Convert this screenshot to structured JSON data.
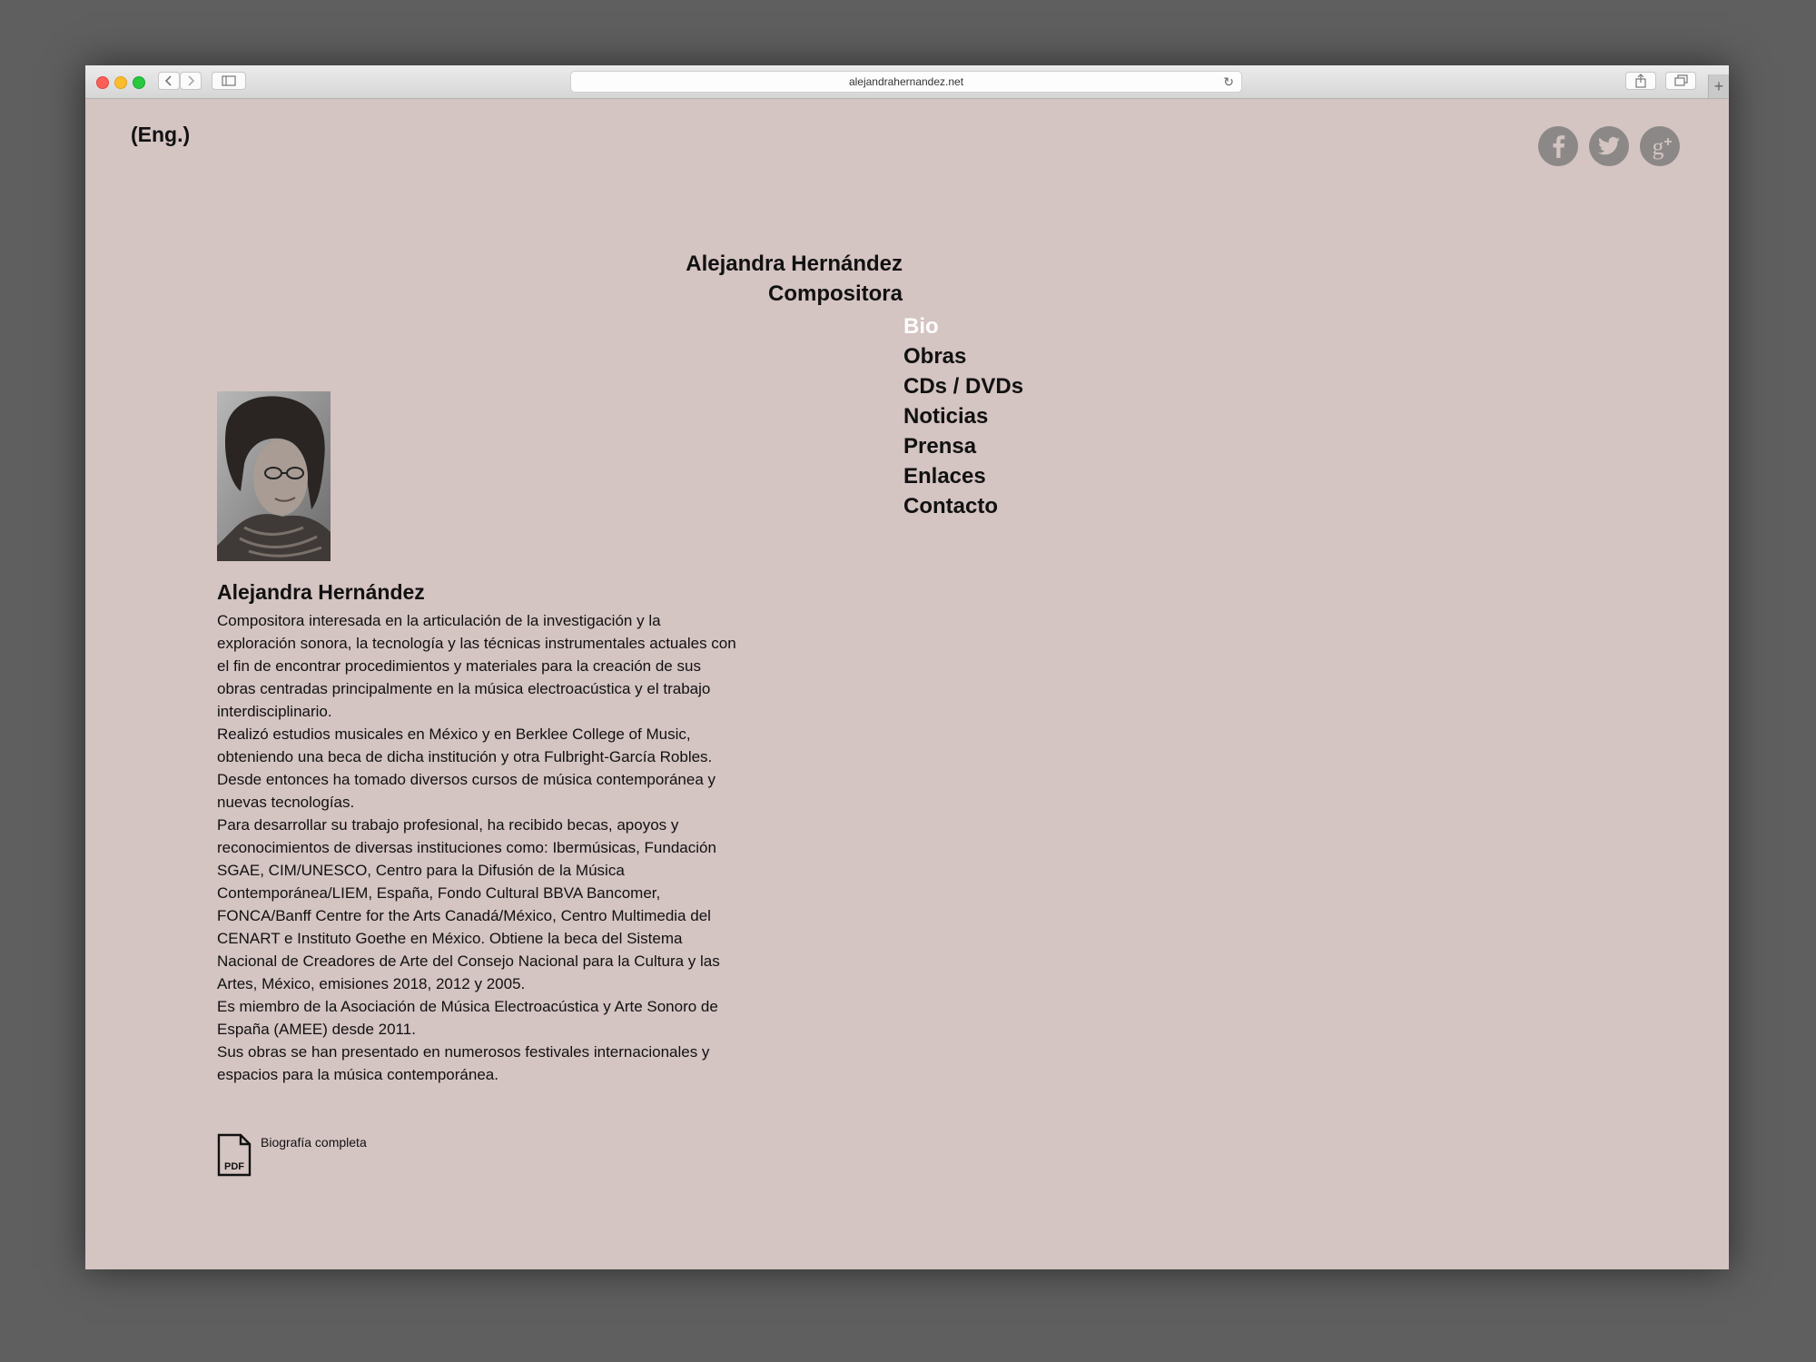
{
  "browser": {
    "url": "alejandrahernandez.net",
    "back_icon": "chevron-left-icon",
    "forward_icon": "chevron-right-icon",
    "sidebar_icon": "sidebar-icon",
    "reload_icon": "reload-icon",
    "share_icon": "share-icon",
    "tabs_icon": "tabs-icon",
    "new_tab_icon": "plus-icon"
  },
  "header": {
    "language_link": "(Eng.)",
    "social": [
      {
        "name": "facebook",
        "glyph": "f",
        "icon": "facebook-icon"
      },
      {
        "name": "twitter",
        "icon": "twitter-icon"
      },
      {
        "name": "google-plus",
        "glyph": "g+",
        "icon": "google-plus-icon"
      }
    ]
  },
  "site": {
    "name": "Alejandra Hernández",
    "role": "Compositora"
  },
  "nav": {
    "items": [
      "Bio",
      "Obras",
      "CDs / DVDs",
      "Noticias",
      "Prensa",
      "Enlaces",
      "Contacto"
    ],
    "active": "Bio"
  },
  "bio": {
    "title": "Alejandra Hernández",
    "paragraphs": [
      "Compositora interesada en la articulación de la investigación y la exploración sonora, la tecnología y las técnicas instrumentales actuales con el fin de encontrar procedimientos y materiales para la creación de sus obras centradas principalmente en la música electroacústica y el trabajo interdisciplinario.",
      "Realizó estudios musicales en México y en Berklee College of Music, obteniendo una beca de dicha institución y otra Fulbright-García Robles. Desde entonces ha tomado diversos cursos de música contemporánea y nuevas tecnologías.",
      "Para desarrollar su trabajo profesional, ha recibido becas, apoyos y reconocimientos de diversas instituciones como: Ibermúsicas, Fundación SGAE, CIM/UNESCO, Centro para la Difusión de la Música Contemporánea/LIEM, España, Fondo Cultural BBVA Bancomer, FONCA/Banff Centre for the Arts Canadá/México, Centro Multimedia del CENART e Instituto Goethe en México. Obtiene la beca del Sistema Nacional de Creadores de Arte del Consejo Nacional para la Cultura y las Artes, México, emisiones 2018, 2012 y 2005.",
      "Es miembro de la Asociación de Música Electroacústica y Arte Sonoro de España (AMEE) desde 2011.",
      "Sus obras se han presentado en numerosos festivales internacionales y espacios para la música contemporánea."
    ],
    "pdf_badge": "PDF",
    "pdf_label": "Biografía completa"
  }
}
